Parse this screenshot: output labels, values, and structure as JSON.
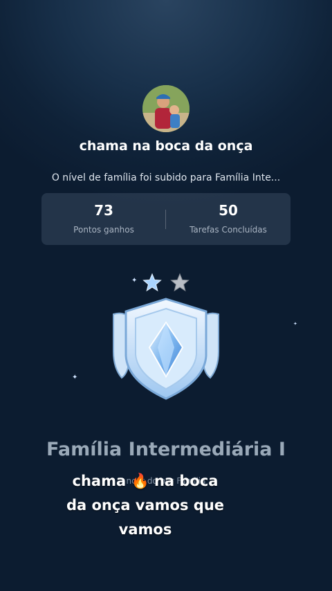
{
  "profile": {
    "name": "chama na boca da onça",
    "level_message": "O nível de família foi subido para Família Inte..."
  },
  "stats": [
    {
      "value": "73",
      "label": "Pontos ganhos"
    },
    {
      "value": "50",
      "label": "Tarefas Concluídas"
    }
  ],
  "badge": {
    "stars_filled": 1,
    "stars_total": 2,
    "level_name": "Família Intermediária I",
    "caption_partial": "ncer do por Familia"
  },
  "video_caption": {
    "line1_a": "chama",
    "line1_emoji": "🔥",
    "line1_b": "na boca",
    "line2": "da onça vamos que",
    "line3": "vamos"
  },
  "colors": {
    "background": "#12263d",
    "stats_panel": "#3a4d63",
    "star_filled": "#a9d4ff",
    "star_empty": "#b9bec6"
  }
}
